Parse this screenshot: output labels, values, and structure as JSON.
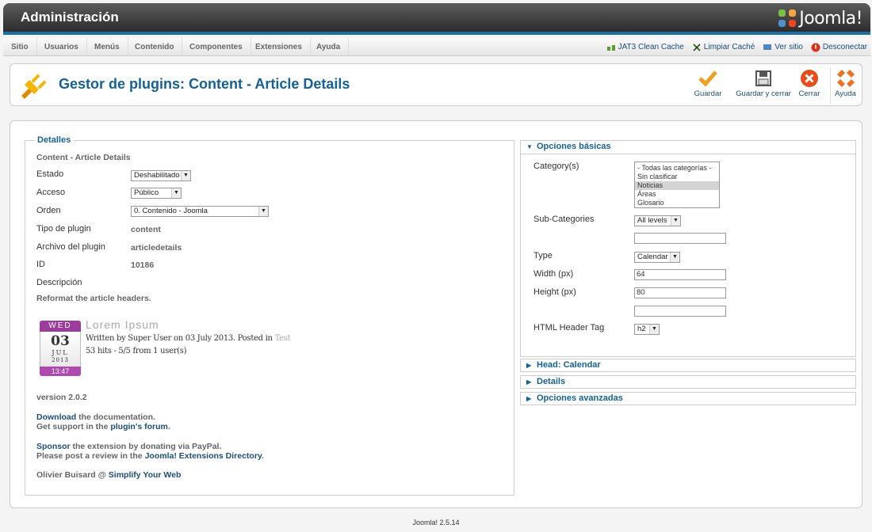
{
  "header": {
    "title": "Administración",
    "logo_text": "Joomla!"
  },
  "menu": [
    "Sitio",
    "Usuarios",
    "Menús",
    "Contenido",
    "Componentes",
    "Extensiones",
    "Ayuda"
  ],
  "quick_links": {
    "jat3": "JAT3 Clean Cache",
    "clear": "Limpiar Caché",
    "view": "Ver sitio",
    "logout": "Desconectar"
  },
  "page": {
    "title": "Gestor de plugins: Content - Article Details"
  },
  "toolbar": {
    "save": "Guardar",
    "save_close": "Guardar y cerrar",
    "close": "Cerrar",
    "help": "Ayuda"
  },
  "details": {
    "legend": "Detalles",
    "plugin_name": "Content - Article Details",
    "state_label": "Estado",
    "state_value": "Deshabilitado",
    "access_label": "Acceso",
    "access_value": "Público",
    "order_label": "Orden",
    "order_value": "0. Contenido - Joomla",
    "type_label": "Tipo de plugin",
    "type_value": "content",
    "file_label": "Archivo del plugin",
    "file_value": "articledetails",
    "id_label": "ID",
    "id_value": "10186",
    "desc_label": "Descripción",
    "desc_text": "Reformat the article headers.",
    "calendar": {
      "day": "WED",
      "date": "03",
      "month": "JUL",
      "year": "2013",
      "time": "13:47"
    },
    "article_title": "Lorem Ipsum",
    "written_by": "Written by Super User on 03 July 2013. Posted in",
    "posted_cat": "Test",
    "hits": "53 hits - 5/5 from 1 user(s)",
    "version": "version 2.0.2",
    "download_link": "Download",
    "download_text": " the documentation.",
    "support_text": "Get support in the ",
    "forum_link": "plugin's forum",
    "sponsor_link": "Sponsor",
    "sponsor_text": " the extension by donating via PayPal.",
    "review_text": "Please post a review in the ",
    "jed_link": "Joomla! Extensions Directory",
    "author_text": "Olivier Buisard @ ",
    "author_link": "Simplify Your Web"
  },
  "options": {
    "header": "Opciones básicas",
    "category_label": "Category(s)",
    "category_options": [
      "- Todas las categorías -",
      "Sin clasificar",
      "Noticias",
      "Áreas",
      "Glosario"
    ],
    "subcat_label": "Sub-Categories",
    "subcat_value": "All levels",
    "type_label": "Type",
    "type_value": "Calendar",
    "width_label": "Width (px)",
    "width_value": "64",
    "height_label": "Height (px)",
    "height_value": "80",
    "htmltag_label": "HTML Header Tag",
    "htmltag_value": "h2"
  },
  "accordion": {
    "calendar": "Head: Calendar",
    "details": "Details",
    "advanced": "Opciones avanzadas"
  },
  "footer": {
    "version": "Joomla! 2.5.14"
  },
  "colors": {
    "accent": "#146295",
    "save": "#f0a020",
    "close": "#e84c1a",
    "calendar": "#9d3c9d"
  }
}
